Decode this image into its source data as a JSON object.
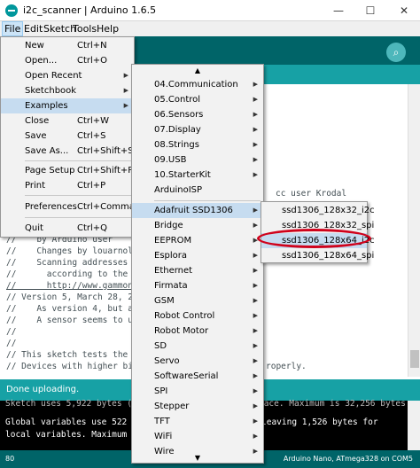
{
  "window": {
    "title": "i2c_scanner | Arduino 1.6.5",
    "min": "—",
    "max": "☐",
    "close": "✕"
  },
  "menubar": [
    "File",
    "Edit",
    "Sketch",
    "Tools",
    "Help"
  ],
  "file_menu": [
    {
      "label": "New",
      "shortcut": "Ctrl+N"
    },
    {
      "label": "Open...",
      "shortcut": "Ctrl+O"
    },
    {
      "label": "Open Recent",
      "arrow": "▶"
    },
    {
      "label": "Sketchbook",
      "arrow": "▶"
    },
    {
      "label": "Examples",
      "arrow": "▶"
    },
    {
      "label": "Close",
      "shortcut": "Ctrl+W"
    },
    {
      "label": "Save",
      "shortcut": "Ctrl+S"
    },
    {
      "label": "Save As...",
      "shortcut": "Ctrl+Shift+S"
    },
    {
      "label": "Page Setup",
      "shortcut": "Ctrl+Shift+P"
    },
    {
      "label": "Print",
      "shortcut": "Ctrl+P"
    },
    {
      "label": "Preferences",
      "shortcut": "Ctrl+Comma"
    },
    {
      "label": "Quit",
      "shortcut": "Ctrl+Q"
    }
  ],
  "examples_menu": {
    "scroll_up": "▲",
    "scroll_down": "▼",
    "items": [
      {
        "label": "04.Communication",
        "arrow": "▶"
      },
      {
        "label": "05.Control",
        "arrow": "▶"
      },
      {
        "label": "06.Sensors",
        "arrow": "▶"
      },
      {
        "label": "07.Display",
        "arrow": "▶"
      },
      {
        "label": "08.Strings",
        "arrow": "▶"
      },
      {
        "label": "09.USB",
        "arrow": "▶"
      },
      {
        "label": "10.StarterKit",
        "arrow": "▶"
      },
      {
        "label": "ArduinoISP",
        "arrow": ""
      },
      {
        "label": "Adafruit SSD1306",
        "arrow": "▶"
      },
      {
        "label": "Bridge",
        "arrow": "▶"
      },
      {
        "label": "EEPROM",
        "arrow": "▶"
      },
      {
        "label": "Esplora",
        "arrow": "▶"
      },
      {
        "label": "Ethernet",
        "arrow": "▶"
      },
      {
        "label": "Firmata",
        "arrow": "▶"
      },
      {
        "label": "GSM",
        "arrow": "▶"
      },
      {
        "label": "Robot Control",
        "arrow": "▶"
      },
      {
        "label": "Robot Motor",
        "arrow": "▶"
      },
      {
        "label": "SD",
        "arrow": "▶"
      },
      {
        "label": "Servo",
        "arrow": "▶"
      },
      {
        "label": "SoftwareSerial",
        "arrow": "▶"
      },
      {
        "label": "SPI",
        "arrow": "▶"
      },
      {
        "label": "Stepper",
        "arrow": "▶"
      },
      {
        "label": "TFT",
        "arrow": "▶"
      },
      {
        "label": "WiFi",
        "arrow": "▶"
      },
      {
        "label": "Wire",
        "arrow": "▶"
      }
    ]
  },
  "ssd1306_menu": [
    "ssd1306_128x32_i2c",
    "ssd1306_128x32_spi",
    "ssd1306_128x64_i2c",
    "ssd1306_128x64_spi"
  ],
  "editor": {
    "frag_user": "cc user Krodal",
    "frag_properly": "roperly.",
    "lines": [
      "//    by Arduino user",
      "//    Changes by louarnold",
      "//    Scanning addresses c",
      "//      according to the i2c",
      "//      http://www.gammon.co",
      "// Version 5, March 28, 20",
      "//    As version 4, but ad",
      "//    A sensor seems to us",
      "//",
      "//",
      "// This sketch tests the s",
      "// Devices with higher bit"
    ]
  },
  "status": {
    "message": "Done uploading."
  },
  "console": {
    "line1": "Sketch uses 5,922 bytes (18%) of program storage space. Maximum is 32,256 bytes.",
    "line2a": "Global variables use 522 by",
    "line2b": "leaving 1,526 bytes for",
    "line3": "local variables. Maximum is"
  },
  "footer": {
    "line_number": "80",
    "board": "Arduino Nano, ATmega328 on COM5"
  }
}
